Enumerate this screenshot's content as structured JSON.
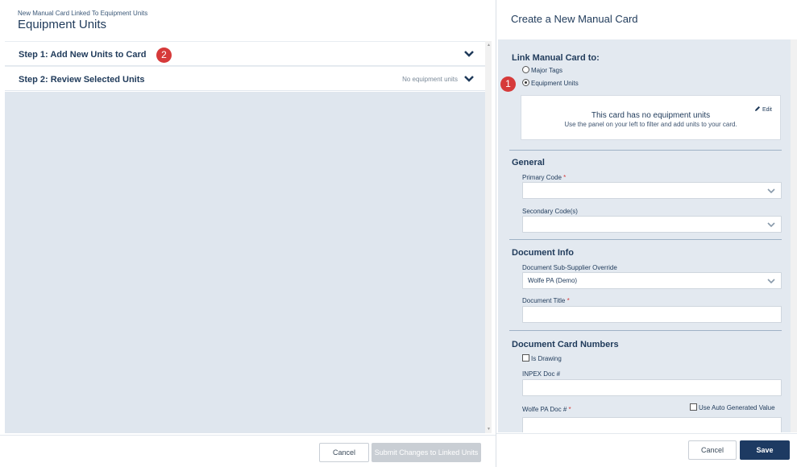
{
  "left": {
    "subtitle": "New Manual Card Linked To Equipment Units",
    "title": "Equipment Units",
    "steps": [
      {
        "label": "Step 1: Add New Units to Card",
        "note": ""
      },
      {
        "label": "Step 2: Review Selected Units",
        "note": "No equipment units"
      }
    ],
    "badge_2": "2",
    "footer": {
      "cancel_label": "Cancel",
      "submit_label": "Submit Changes to Linked Units"
    }
  },
  "right": {
    "title": "Create a New Manual Card",
    "link": {
      "heading": "Link Manual Card to:",
      "options": [
        "Major Tags",
        "Equipment Units"
      ],
      "selected": "Equipment Units",
      "badge_1": "1",
      "box_title": "This card has no equipment units",
      "box_hint": "Use the panel on your left to filter and add units to your card.",
      "edit_label": "Edit"
    },
    "general": {
      "heading": "General",
      "primary_code_label": "Primary Code",
      "primary_code_value": "",
      "secondary_code_label": "Secondary Code(s)",
      "secondary_code_value": ""
    },
    "document_info": {
      "heading": "Document Info",
      "sub_supplier_label": "Document Sub-Supplier Override",
      "sub_supplier_value": "Wolfe PA (Demo)",
      "title_label": "Document Title",
      "title_value": ""
    },
    "card_numbers": {
      "heading": "Document Card Numbers",
      "is_drawing_label": "Is Drawing",
      "inpex_label": "INPEX Doc #",
      "inpex_value": "",
      "wolfe_label": "Wolfe PA Doc #",
      "wolfe_value": "",
      "auto_label": "Use Auto Generated Value"
    },
    "required_mark": "*",
    "footer": {
      "cancel_label": "Cancel",
      "save_label": "Save"
    }
  },
  "colors": {
    "primary": "#1d3a62",
    "badge": "#d63a3a",
    "panel_bg": "#e3e9f0",
    "disabled": "#c9ced4"
  },
  "icons": {
    "chevron": "chevron-down-icon",
    "edit": "pencil-icon",
    "dropdown": "chevron-down-icon"
  }
}
